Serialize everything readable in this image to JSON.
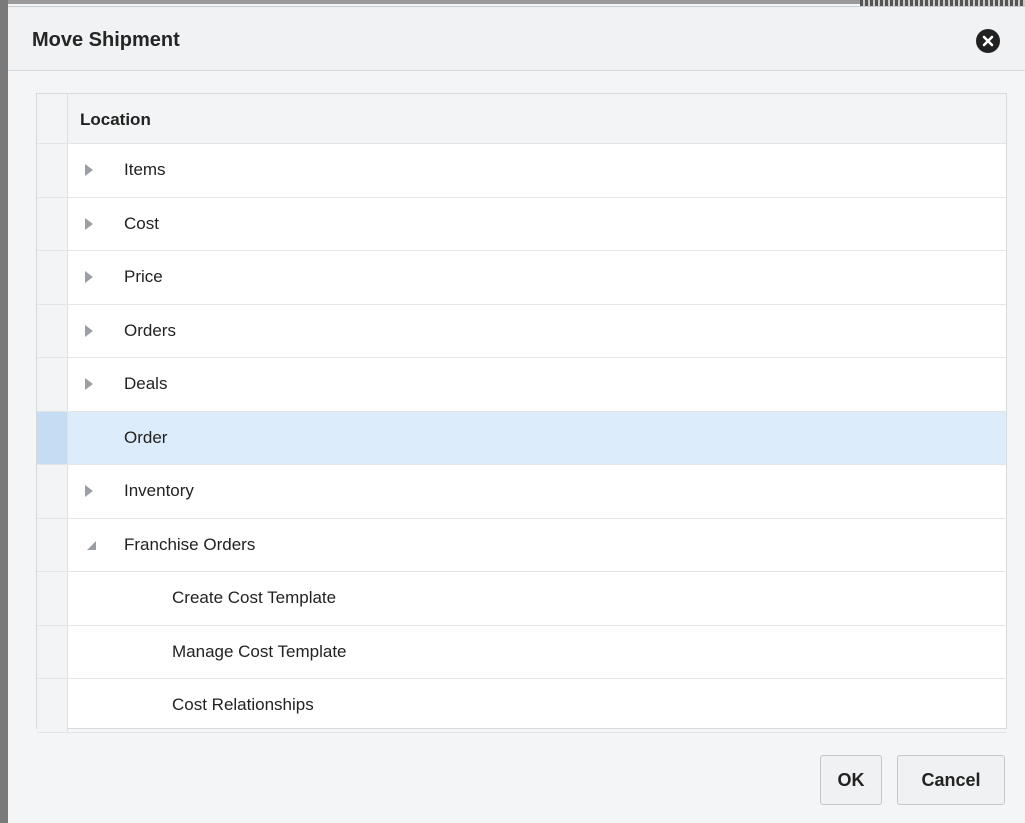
{
  "dialog": {
    "title": "Move Shipment",
    "close_icon": "close-circle-icon"
  },
  "table": {
    "header": "Location",
    "rows": [
      {
        "label": "Items",
        "expander": "collapsed",
        "level": 1,
        "selected": false
      },
      {
        "label": "Cost",
        "expander": "collapsed",
        "level": 1,
        "selected": false
      },
      {
        "label": "Price",
        "expander": "collapsed",
        "level": 1,
        "selected": false
      },
      {
        "label": "Orders",
        "expander": "collapsed",
        "level": 1,
        "selected": false
      },
      {
        "label": "Deals",
        "expander": "collapsed",
        "level": 1,
        "selected": false
      },
      {
        "label": "Order",
        "expander": "none",
        "level": 1,
        "selected": true
      },
      {
        "label": "Inventory",
        "expander": "collapsed",
        "level": 1,
        "selected": false
      },
      {
        "label": "Franchise Orders",
        "expander": "expanded",
        "level": 1,
        "selected": false
      },
      {
        "label": "Create Cost Template",
        "expander": "none",
        "level": 2,
        "selected": false
      },
      {
        "label": "Manage Cost Template",
        "expander": "none",
        "level": 2,
        "selected": false
      },
      {
        "label": "Cost Relationships",
        "expander": "none",
        "level": 2,
        "selected": false
      }
    ]
  },
  "buttons": {
    "ok": "OK",
    "cancel": "Cancel"
  },
  "colors": {
    "selected_row": "#dcecfa",
    "expander": "#9b9fa3"
  }
}
